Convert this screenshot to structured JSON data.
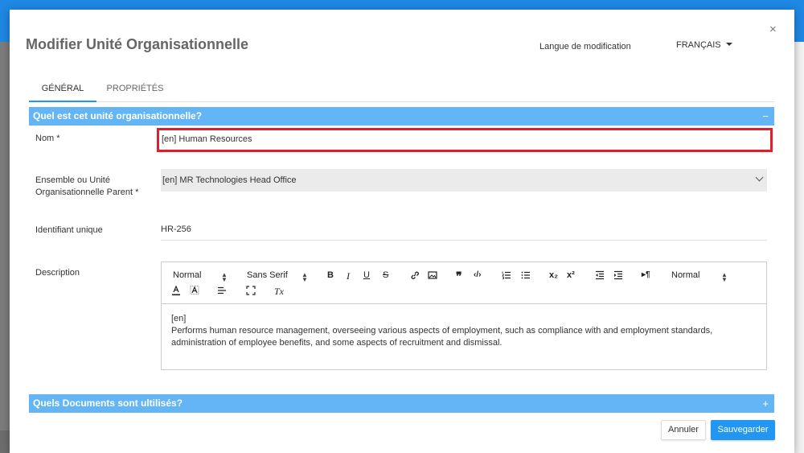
{
  "modal": {
    "title": "Modifier Unité Organisationnelle",
    "close_icon": "×",
    "language_label": "Langue de modification",
    "language_value": "FRANÇAIS"
  },
  "tabs": [
    {
      "label": "GÉNÉRAL",
      "active": true
    },
    {
      "label": "PROPRIÉTÉS",
      "active": false
    }
  ],
  "section1": {
    "title": "Quel est cet unité organisationnelle?",
    "toggle": "−"
  },
  "fields": {
    "nom_label": "Nom *",
    "nom_value": "[en] Human Resources",
    "parent_label_line1": "Ensemble ou Unité",
    "parent_label_line2": "Organisationnelle Parent *",
    "parent_value": "[en] MR Technologies Head Office",
    "uid_label": "Identifiant unique",
    "uid_value": "HR-256",
    "description_label": "Description"
  },
  "editor": {
    "toolbar": {
      "header_select": "Normal",
      "font_select": "Sans Serif",
      "size_select": "Normal",
      "bold": "B",
      "italic": "I",
      "underline": "U",
      "strike": "S",
      "quote": "❞",
      "code": "‹/›",
      "subscript": "x₂",
      "superscript": "x²",
      "direction": "▸¶",
      "clean": "Tx"
    },
    "content_line1": "[en]",
    "content_line2": "Performs human resource management, overseeing various aspects of employment, such as compliance with and employment standards, administration of employee benefits, and some aspects of recruitment and dismissal."
  },
  "section2": {
    "title": "Quels Documents sont ultilisés?",
    "toggle": "+"
  },
  "actions": {
    "cancel": "Annuler",
    "save": "Sauvegarder"
  },
  "colors": {
    "header_bar": "#1e88e5",
    "section_bar": "#64b5f6",
    "focus_border": "#e01e2d",
    "primary_button": "#2196f3"
  }
}
